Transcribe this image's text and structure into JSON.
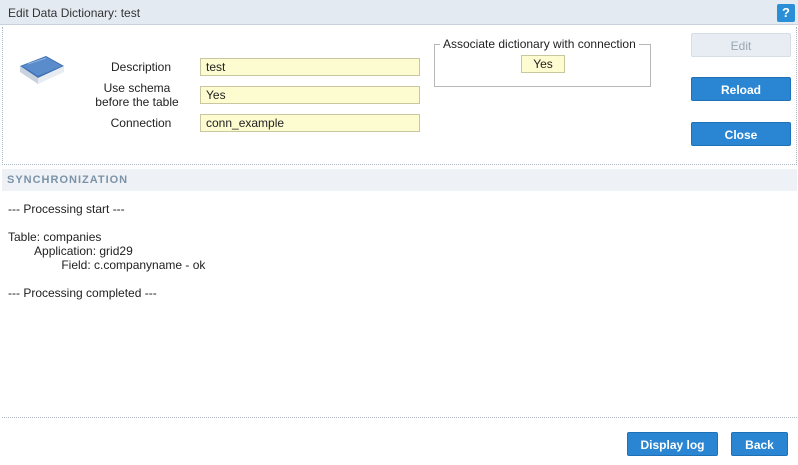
{
  "window": {
    "title": "Edit Data Dictionary: test",
    "help_label": "?"
  },
  "form": {
    "description_label": "Description",
    "description_value": "test",
    "schema_label_line1": "Use schema",
    "schema_label_line2": "before the table",
    "schema_value": "Yes",
    "connection_label": "Connection",
    "connection_value": "conn_example"
  },
  "association": {
    "legend": "Associate dictionary with connection",
    "value": "Yes"
  },
  "buttons": {
    "edit": "Edit",
    "reload": "Reload",
    "close": "Close",
    "display_log": "Display log",
    "back": "Back"
  },
  "sync": {
    "header": "SYNCHRONIZATION",
    "log_lines": [
      "--- Processing start ---",
      "",
      "Table: companies",
      "        Application: grid29",
      "                Field: c.companyname - ok",
      "",
      "--- Processing completed ---"
    ]
  },
  "colors": {
    "primary": "#2a86d2",
    "input_bg": "#fdfbd0",
    "titlebar_bg": "#e4eaf1",
    "section_text": "#7b92a8"
  },
  "icons": {
    "dictionary": "book-icon"
  }
}
